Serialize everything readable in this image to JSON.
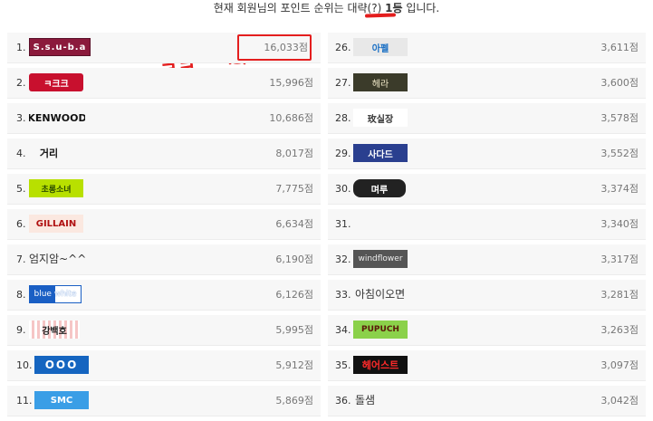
{
  "header": {
    "prefix": "현재 회원님의 포인트 순위는 대략(?) ",
    "rank": "1등",
    "suffix": " 입니다."
  },
  "scribbles": {
    "kk1": "ㅋ",
    "kk2": "ㅋㅋ"
  },
  "left": [
    {
      "rank": "1.",
      "badge": "S.s.u-b.a",
      "points": "16,033점"
    },
    {
      "rank": "2.",
      "badge": "ㅋ크크",
      "points": "15,996점"
    },
    {
      "rank": "3.",
      "badge": "KENWOOD",
      "points": "10,686점"
    },
    {
      "rank": "4.",
      "badge": "거리",
      "points": "8,017점"
    },
    {
      "rank": "5.",
      "badge": "초롱소녀",
      "points": "7,775점"
    },
    {
      "rank": "6.",
      "badge": "GILLAIN",
      "points": "6,634점"
    },
    {
      "rank": "7.",
      "name": "엄지암~^^",
      "points": "6,190점"
    },
    {
      "rank": "8.",
      "badge": "blue white",
      "points": "6,126점"
    },
    {
      "rank": "9.",
      "badge": "강백호",
      "points": "5,995점"
    },
    {
      "rank": "10.",
      "badge": "OOO",
      "points": "5,912점"
    },
    {
      "rank": "11.",
      "badge": "SMC",
      "points": "5,869점"
    }
  ],
  "right": [
    {
      "rank": "26.",
      "badge": "아펠",
      "points": "3,611점"
    },
    {
      "rank": "27.",
      "badge": "헤라",
      "points": "3,600점"
    },
    {
      "rank": "28.",
      "badge": "玫실장",
      "points": "3,578점"
    },
    {
      "rank": "29.",
      "badge": "사다드",
      "points": "3,552점"
    },
    {
      "rank": "30.",
      "badge": "며루",
      "points": "3,374점"
    },
    {
      "rank": "31.",
      "name": "",
      "points": "3,340점"
    },
    {
      "rank": "32.",
      "badge": "windflower",
      "points": "3,317점"
    },
    {
      "rank": "33.",
      "name": "아침이오면",
      "points": "3,281점"
    },
    {
      "rank": "34.",
      "badge": "PUPUCH",
      "points": "3,263점"
    },
    {
      "rank": "35.",
      "badge": "헤어스트",
      "points": "3,097점"
    },
    {
      "rank": "36.",
      "name": "돌샘",
      "points": "3,042점"
    }
  ],
  "colors": {
    "annotation": "#e41e1e",
    "row_bg": "#f7f7f7"
  }
}
